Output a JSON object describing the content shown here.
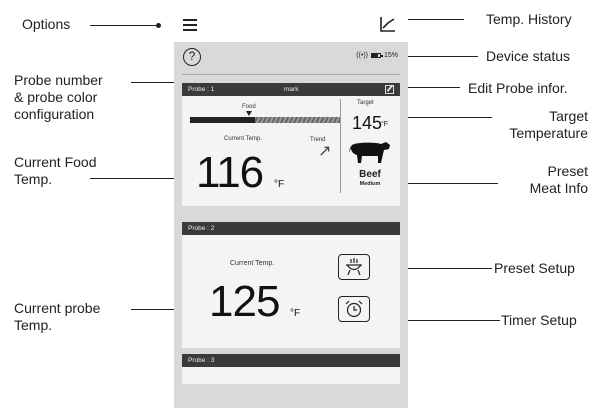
{
  "callouts": {
    "options": "Options",
    "probe_number_l1": "Probe number",
    "probe_number_l2": "& probe color",
    "probe_number_l3": "configuration",
    "current_food_l1": "Current Food",
    "current_food_l2": "Temp.",
    "current_probe_l1": "Current probe",
    "current_probe_l2": "Temp.",
    "temp_history": "Temp. History",
    "device_status": "Device status",
    "edit_probe": "Edit Probe infor.",
    "target_l1": "Target",
    "target_l2": "Temperature",
    "preset_meat_l1": "Preset",
    "preset_meat_l2": "Meat Info",
    "preset_setup": "Preset Setup",
    "timer_setup": "Timer Setup"
  },
  "topbar": {
    "menu_icon": "menu-icon",
    "history_icon": "history-chart-icon"
  },
  "phone": {
    "help_symbol": "?",
    "status": {
      "wifi": "((•))",
      "battery_percent": "15%"
    },
    "probe1": {
      "label": "Probe : 1",
      "name": "mark",
      "food_label": "Food",
      "food_progress_fraction": 0.43,
      "current_label": "Current Temp.",
      "current_value": "116",
      "current_unit": "°F",
      "trend_label": "Trend",
      "trend_symbol": "↗",
      "target_label": "Target",
      "target_value": "145",
      "target_unit": "°F",
      "meat": "Beef",
      "doneness": "Medium"
    },
    "probe2": {
      "label": "Probe : 2",
      "current_label": "Current Temp.",
      "current_value": "125",
      "current_unit": "°F"
    },
    "probe3": {
      "label": "Probe : 3"
    }
  }
}
